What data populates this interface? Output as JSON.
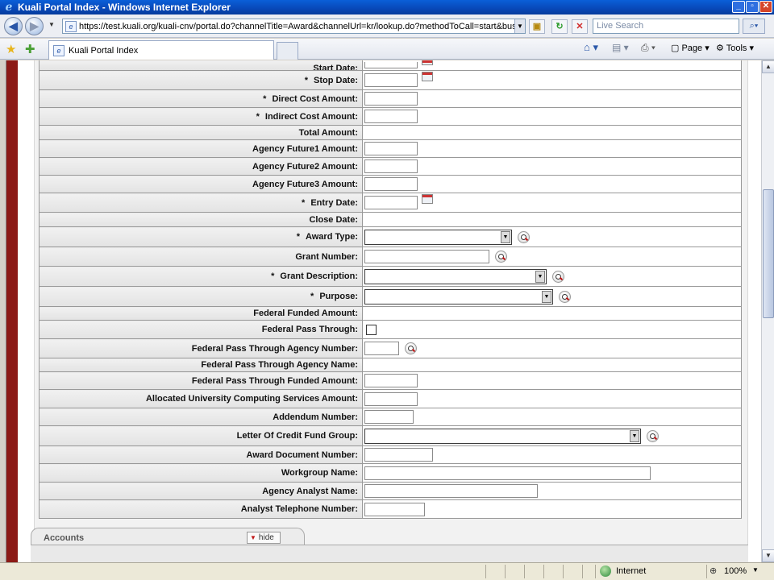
{
  "window": {
    "title": "Kuali Portal Index - Windows Internet Explorer",
    "min_label": "_",
    "max_label": "▫",
    "close_label": "✕"
  },
  "address_bar": {
    "url": "https://test.kuali.org/kuali-cnv/portal.do?channelTitle=Award&channelUrl=kr/lookup.do?methodToCall=start&businessObj",
    "search_placeholder": "Live Search"
  },
  "tab": {
    "title": "Kuali Portal Index"
  },
  "command_bar": {
    "page_label": "Page",
    "tools_label": "Tools"
  },
  "form": {
    "required_marker": "*",
    "rows": [
      {
        "label": "Start Date:",
        "required": false
      },
      {
        "label": "Stop Date:",
        "required": true
      },
      {
        "label": "Direct Cost Amount:",
        "required": true
      },
      {
        "label": "Indirect Cost Amount:",
        "required": true
      },
      {
        "label": "Total Amount:",
        "required": false
      },
      {
        "label": "Agency Future1 Amount:",
        "required": false
      },
      {
        "label": "Agency Future2 Amount:",
        "required": false
      },
      {
        "label": "Agency Future3 Amount:",
        "required": false
      },
      {
        "label": "Entry Date:",
        "required": true
      },
      {
        "label": "Close Date:",
        "required": false
      },
      {
        "label": "Award Type:",
        "required": true
      },
      {
        "label": "Grant Number:",
        "required": false
      },
      {
        "label": "Grant Description:",
        "required": true
      },
      {
        "label": "Purpose:",
        "required": true
      },
      {
        "label": "Federal Funded Amount:",
        "required": false
      },
      {
        "label": "Federal Pass Through:",
        "required": false
      },
      {
        "label": "Federal Pass Through Agency Number:",
        "required": false
      },
      {
        "label": "Federal Pass Through Agency Name:",
        "required": false
      },
      {
        "label": "Federal Pass Through Funded Amount:",
        "required": false
      },
      {
        "label": "Allocated University Computing Services Amount:",
        "required": false
      },
      {
        "label": "Addendum Number:",
        "required": false
      },
      {
        "label": "Letter Of Credit Fund Group:",
        "required": false
      },
      {
        "label": "Award Document Number:",
        "required": false
      },
      {
        "label": "Workgroup Name:",
        "required": false
      },
      {
        "label": "Agency Analyst Name:",
        "required": false
      },
      {
        "label": "Analyst Telephone Number:",
        "required": false
      }
    ]
  },
  "accounts_section": {
    "title": "Accounts",
    "hide_label": "hide"
  },
  "status_bar": {
    "zone": "Internet",
    "zoom": "100%"
  }
}
